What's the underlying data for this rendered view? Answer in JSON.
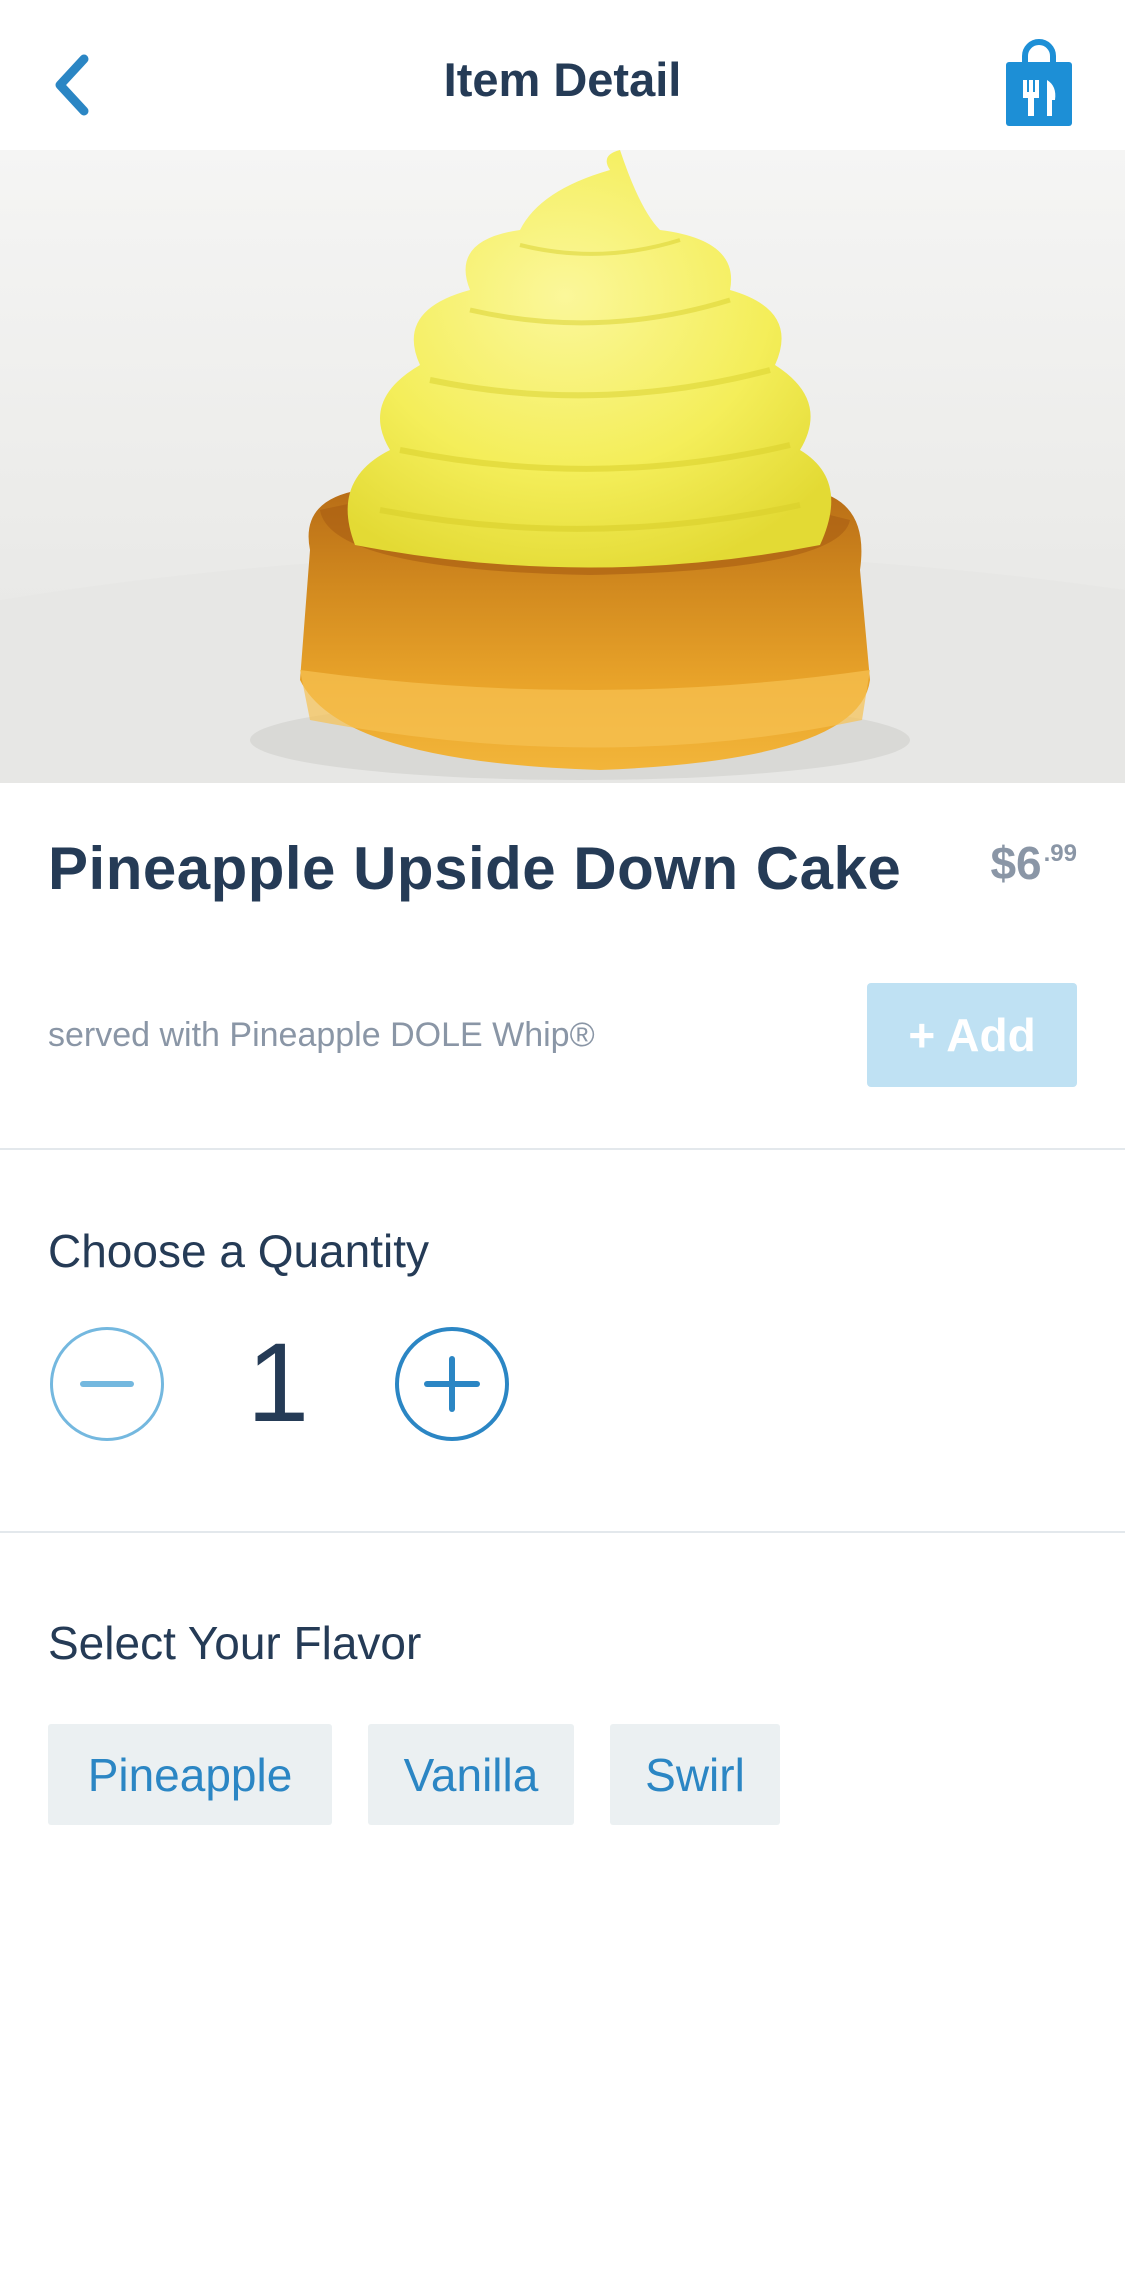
{
  "header": {
    "title": "Item Detail",
    "back_icon": "chevron-left-icon",
    "bag_icon": "shopping-bag-utensils-icon"
  },
  "hero": {
    "image": "pineapple-upside-down-cake-with-dole-whip-swirl"
  },
  "item": {
    "name": "Pineapple Upside Down Cake",
    "price_dollars": "$6",
    "price_cents": ".99",
    "description": "served with Pineapple DOLE Whip®",
    "add_label": "+ Add"
  },
  "quantity": {
    "label": "Choose a Quantity",
    "value": "1",
    "minus_icon": "minus-circle-icon",
    "plus_icon": "plus-circle-icon"
  },
  "flavor": {
    "label": "Select Your Flavor",
    "options": [
      "Pineapple",
      "Vanilla",
      "Swirl"
    ]
  },
  "colors": {
    "accent": "#2b86c4",
    "text_dark": "#253b56",
    "text_muted": "#8a96a6",
    "add_disabled": "#bfe1f3",
    "chip_bg": "#ebf0f2"
  }
}
